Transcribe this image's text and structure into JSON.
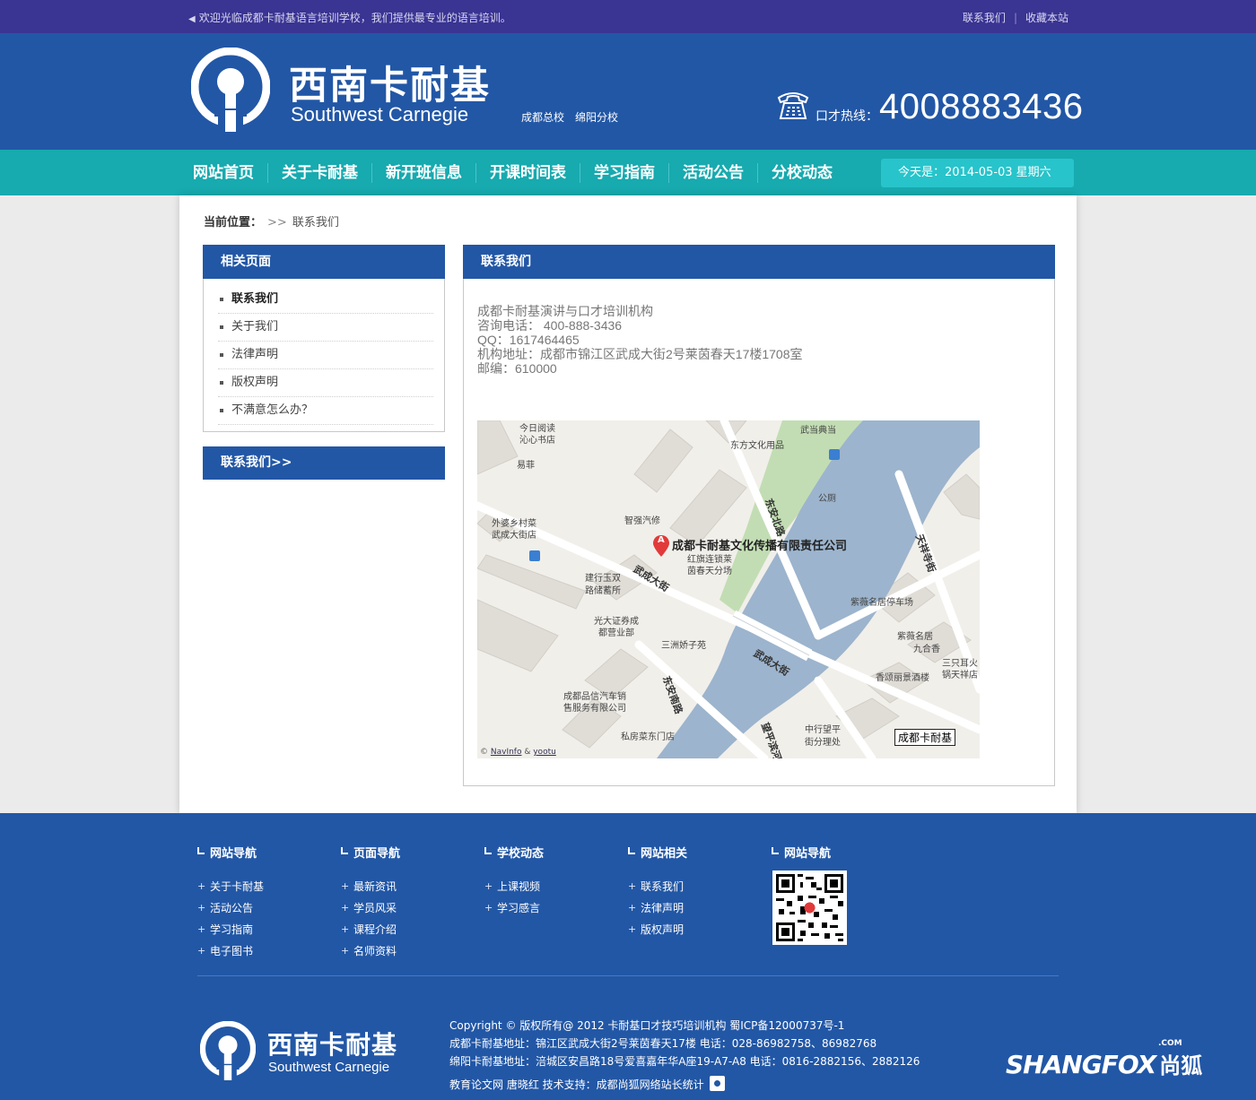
{
  "topbar": {
    "welcome": "欢迎光临成都卡耐基语言培训学校，我们提供最专业的语言培训。",
    "contact": "联系我们",
    "separator": "|",
    "bookmark": "收藏本站"
  },
  "header": {
    "brand_cn": "西南卡耐基",
    "brand_en": "Southwest Carnegie",
    "branches": [
      "成都总校",
      "绵阳分校"
    ],
    "hotline_label": "口才热线：",
    "hotline_number": "4008883436"
  },
  "nav": {
    "items": [
      "网站首页",
      "关于卡耐基",
      "新开班信息",
      "开课时间表",
      "学习指南",
      "活动公告",
      "分校动态"
    ],
    "date": "今天是：2014-05-03 星期六"
  },
  "breadcrumb": {
    "label": "当前位置：",
    "arrow": ">>",
    "current": "联系我们"
  },
  "sidebar": {
    "title": "相关页面",
    "items": [
      "联系我们",
      "关于我们",
      "法律声明",
      "版权声明",
      "不满意怎么办？"
    ],
    "contact_link": "联系我们>>"
  },
  "content": {
    "title": "联系我们",
    "lines": [
      "成都卡耐基演讲与口才培训机构",
      "咨询电话： 400-888-3436",
      "QQ：1617464465",
      "机构地址：成都市锦江区武成大街2号莱茵春天17楼1708室",
      "邮编：610000"
    ]
  },
  "map": {
    "company": "成都卡耐基文化传播有限责任公司",
    "marker": "A",
    "tag": "成都卡耐基",
    "credit_prefix": "© ",
    "credit_a": "NavInfo",
    "credit_amp": " & ",
    "credit_b": "yootu",
    "labels": {
      "l1": "今日阅读",
      "l2": "沁心书店",
      "l3": "易菲",
      "l4": "外婆乡村菜",
      "l5": "武成大街店",
      "l6": "智强汽修",
      "l7": "红旗连锁莱",
      "l8": "茵春天分场",
      "l9": "建行玉双",
      "l10": "路储蓄所",
      "l11": "光大证券成",
      "l12": "都营业部",
      "l13": "三洲娇子苑",
      "l14": "成都品信汽车销",
      "l15": "售服务有限公司",
      "l16": "私房菜东门店",
      "l17": "东方文化用品",
      "l18": "武当典当",
      "l19": "公厕",
      "l20": "紫薇名居停车场",
      "l21": "紫薇名居",
      "l22": "九合香",
      "l23": "香颂丽景酒楼",
      "l24": "三只耳火",
      "l25": "锅天祥店",
      "l26": "中行望平",
      "l27": "街分理处",
      "r1": "武成大街",
      "r2": "武成大街",
      "r3": "东安北路",
      "r4": "东安南路",
      "r5": "天祥寺街",
      "r6": "望平滨河"
    }
  },
  "footer": {
    "cols": [
      {
        "title": "网站导航",
        "items": [
          "关于卡耐基",
          "活动公告",
          "学习指南",
          "电子图书"
        ]
      },
      {
        "title": "页面导航",
        "items": [
          "最新资讯",
          "学员风采",
          "课程介绍",
          "名师资料"
        ]
      },
      {
        "title": "学校动态",
        "items": [
          "上课视频",
          "学习感言"
        ]
      },
      {
        "title": "网站相关",
        "items": [
          "联系我们",
          "法律声明",
          "版权声明"
        ]
      },
      {
        "title": "网站导航",
        "items": []
      }
    ],
    "brand_cn": "西南卡耐基",
    "brand_en": "Southwest Carnegie",
    "copy": [
      "Copyright © 版权所有@ 2012 卡耐基口才技巧培训机构 蜀ICP备12000737号-1",
      "成都卡耐基地址：锦江区武成大街2号莱茵春天17楼 电话：028-86982758、86982768",
      "绵阳卡耐基地址：涪城区安昌路18号爱喜嘉年华A座19-A7-A8 电话：0816-2882156、2882126",
      "教育论文网 唐晓红 技术支持：成都尚狐网络站长统计"
    ],
    "shangfox": "SHANGFOX",
    "shangfox_com": ".COM",
    "shangfox_cn": "尚狐"
  },
  "colors": {
    "topbar": "#3a3492",
    "header": "#2257a6",
    "nav": "#17aaaf",
    "date_box": "#27c4cb"
  }
}
